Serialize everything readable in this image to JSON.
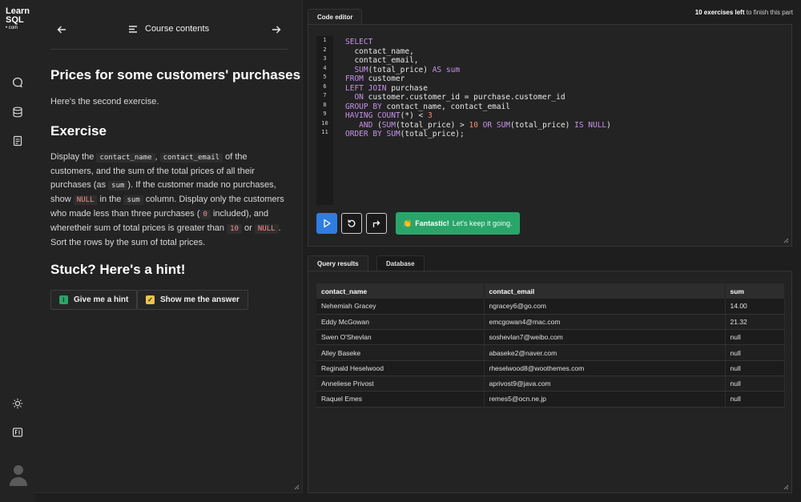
{
  "logo": {
    "line1": "Learn",
    "line2": "SQL",
    "line3": "• com"
  },
  "rail": {
    "icons": [
      "chat-icon",
      "database-icon",
      "notes-icon",
      "theme-icon",
      "keyboard-icon",
      "avatar"
    ]
  },
  "lesson_nav": {
    "title": "Course contents"
  },
  "lesson": {
    "title": "Prices for some customers' purchases",
    "intro": "Here's the second exercise.",
    "exercise_heading": "Exercise",
    "body": {
      "t1": "Display the ",
      "c1": "contact_name",
      "t2": ", ",
      "c2": "contact_email",
      "t3": " of the customers, and the sum of the total prices of all their purchases (as ",
      "c3": "sum",
      "t4": "). If the customer made no purchases, show ",
      "c4": "NULL",
      "t5": " in the ",
      "c5": "sum",
      "t6": " column. Display only the customers who made less than three purchases (",
      "c6": "0",
      "t7": " included), and wheretheir sum of total prices is greater than ",
      "c7": "10",
      "t8": " or ",
      "c8": "NULL",
      "t9": ". Sort the rows by the sum of total prices."
    },
    "stuck_heading": "Stuck? Here's a hint!",
    "hint_button": "Give me a hint",
    "answer_button": "Show me the answer"
  },
  "editor": {
    "tab": "Code editor",
    "exercises_left_bold": "10 exercises left",
    "exercises_left_rest": " to finish this part",
    "line_numbers": [
      "1",
      "2",
      "3",
      "4",
      "5",
      "6",
      "7",
      "8",
      "9",
      "10",
      "11"
    ],
    "toast_bold": "Fantastic!",
    "toast_rest": " Let's keep it going."
  },
  "results": {
    "tabs": [
      "Query results",
      "Database"
    ],
    "columns": [
      "contact_name",
      "contact_email",
      "sum"
    ],
    "rows": [
      [
        "Nehemiah Gracey",
        "ngracey6@go.com",
        "14.00"
      ],
      [
        "Eddy McGowan",
        "emcgowan4@mac.com",
        "21.32"
      ],
      [
        "Swen O'Shevlan",
        "soshevlan7@weibo.com",
        "null"
      ],
      [
        "Alley Baseke",
        "abaseke2@naver.com",
        "null"
      ],
      [
        "Reginald Heselwood",
        "rheselwood8@woothemes.com",
        "null"
      ],
      [
        "Anneliese Privost",
        "aprivost9@java.com",
        "null"
      ],
      [
        "Raquel Emes",
        "remes5@ocn.ne.jp",
        "null"
      ]
    ]
  },
  "colors": {
    "run_button": "#2f7de1",
    "toast": "#2aa56a",
    "keyword": "#c792ea",
    "number": "#f78c6c",
    "hint_icon": "#2aa56a",
    "answer_icon": "#f0c24b"
  }
}
